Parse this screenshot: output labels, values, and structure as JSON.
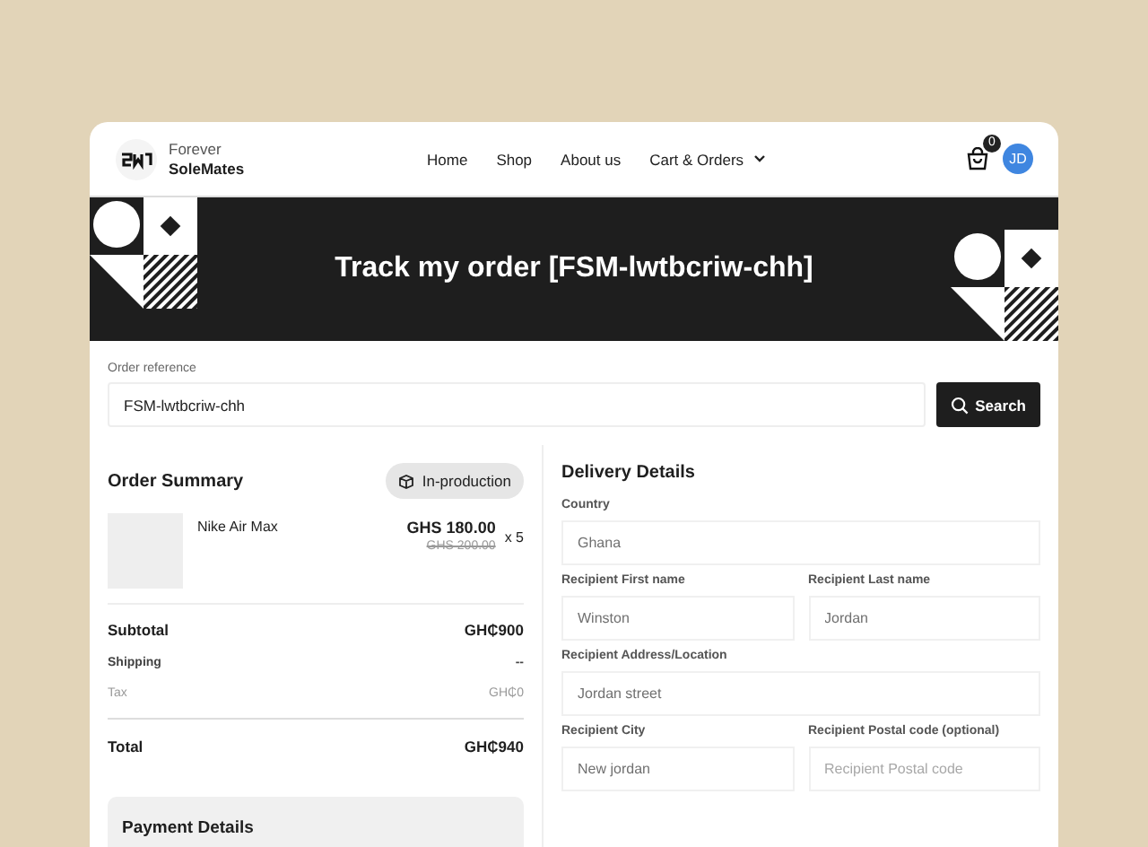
{
  "brand": {
    "line1": "Forever",
    "line2": "SoleMates"
  },
  "nav": [
    {
      "label": "Home",
      "kind": "link"
    },
    {
      "label": "Shop",
      "kind": "link"
    },
    {
      "label": "About us",
      "kind": "link"
    },
    {
      "label": "Cart & Orders",
      "kind": "dropdown"
    }
  ],
  "cart": {
    "count": "0"
  },
  "avatar": {
    "initials": "JD"
  },
  "banner": {
    "title": "Track my order [FSM-lwtbcriw-chh]"
  },
  "search": {
    "label": "Order reference",
    "value": "FSM-lwtbcriw-chh",
    "button": "Search"
  },
  "order_summary": {
    "title": "Order Summary",
    "status": "In-production",
    "items": [
      {
        "name": "Nike Air Max",
        "price": "GHS 180.00",
        "old_price": "GHS 200.00",
        "quantity": "x 5"
      }
    ],
    "totals": [
      {
        "label": "Subtotal",
        "value": "GH₵900",
        "kind": "main"
      },
      {
        "label": "Shipping",
        "value": "--",
        "kind": "minor"
      },
      {
        "label": "Tax",
        "value": "GH₵0",
        "kind": "muted"
      },
      {
        "label": "Total",
        "value": "GH₵940",
        "kind": "total"
      }
    ]
  },
  "payment": {
    "title": "Payment Details"
  },
  "delivery": {
    "title": "Delivery Details",
    "fields": [
      {
        "label": "Country",
        "value": "Ghana",
        "kind": "full"
      },
      {
        "label": "Recipient First name",
        "value": "Winston",
        "kind": "half"
      },
      {
        "label": "Recipient Last name",
        "value": "Jordan",
        "kind": "half"
      },
      {
        "label": "Recipient Address/Location",
        "value": "Jordan street",
        "kind": "full"
      },
      {
        "label": "Recipient City",
        "value": "New jordan",
        "kind": "half"
      },
      {
        "label": "Recipient Postal code (optional)",
        "placeholder": "Recipient Postal code",
        "kind": "half"
      }
    ]
  }
}
